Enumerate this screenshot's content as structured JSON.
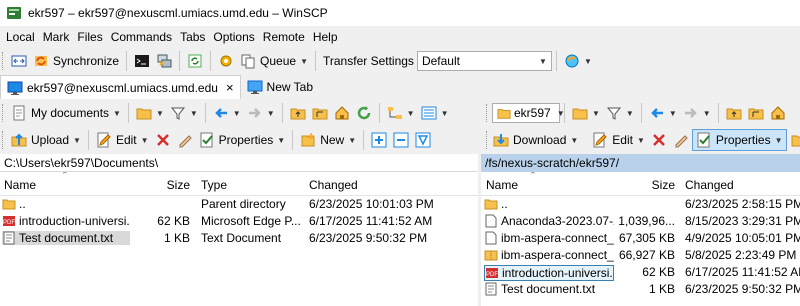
{
  "window": {
    "title": "ekr597 – ekr597@nexuscml.umiacs.umd.edu – WinSCP",
    "icon": "winscp-app-icon"
  },
  "menu": [
    "Local",
    "Mark",
    "Files",
    "Commands",
    "Tabs",
    "Options",
    "Remote",
    "Help"
  ],
  "toolbar": {
    "synchronize": "Synchronize",
    "queue": "Queue",
    "transfer_settings_label": "Transfer Settings",
    "transfer_settings_value": "Default"
  },
  "tabs": [
    {
      "label": "ekr597@nexuscml.umiacs.umd.edu",
      "close": "×"
    },
    {
      "label": "New Tab"
    }
  ],
  "left": {
    "location": "My documents",
    "buttons": {
      "upload": "Upload",
      "edit": "Edit",
      "properties": "Properties",
      "new": "New"
    },
    "path": "C:\\Users\\ekr597\\Documents\\",
    "columns": {
      "name": "Name",
      "size": "Size",
      "type": "Type",
      "changed": "Changed"
    },
    "rows": [
      {
        "icon": "parent-folder-icon",
        "name": "..",
        "size": "",
        "type": "Parent directory",
        "changed": "6/23/2025 10:01:03 PM"
      },
      {
        "icon": "pdf-file-icon",
        "name": "introduction-universi...",
        "size": "62 KB",
        "type": "Microsoft Edge P...",
        "changed": "6/17/2025 11:41:52 AM"
      },
      {
        "icon": "text-file-icon",
        "name": "Test document.txt",
        "size": "1 KB",
        "type": "Text Document",
        "changed": "6/23/2025 9:50:32 PM"
      }
    ]
  },
  "right": {
    "location": "ekr597",
    "buttons": {
      "download": "Download",
      "edit": "Edit",
      "properties": "Properties"
    },
    "path": "/fs/nexus-scratch/ekr597/",
    "columns": {
      "name": "Name",
      "size": "Size",
      "changed": "Changed"
    },
    "rows": [
      {
        "icon": "parent-folder-icon",
        "name": "..",
        "size": "",
        "changed": "6/23/2025 2:58:15 PM"
      },
      {
        "icon": "generic-file-icon",
        "name": "Anaconda3-2023.07-2...",
        "size": "1,039,96...",
        "changed": "8/15/2023 3:29:31 PM"
      },
      {
        "icon": "generic-file-icon",
        "name": "ibm-aspera-connect_...",
        "size": "67,305 KB",
        "changed": "4/9/2025 10:05:01 PM"
      },
      {
        "icon": "archive-file-icon",
        "name": "ibm-aspera-connect_...",
        "size": "66,927 KB",
        "changed": "5/8/2025 2:23:49 PM"
      },
      {
        "icon": "pdf-file-icon",
        "name": "introduction-universi...",
        "size": "62 KB",
        "changed": "6/17/2025 11:41:52 AM"
      },
      {
        "icon": "text-file-icon",
        "name": "Test document.txt",
        "size": "1 KB",
        "changed": "6/23/2025 9:50:32 PM"
      }
    ]
  },
  "colors": {
    "accent": "#0078d7",
    "remote_path_bg": "#b9d1ea",
    "selection_gray": "#d9d9d9"
  }
}
